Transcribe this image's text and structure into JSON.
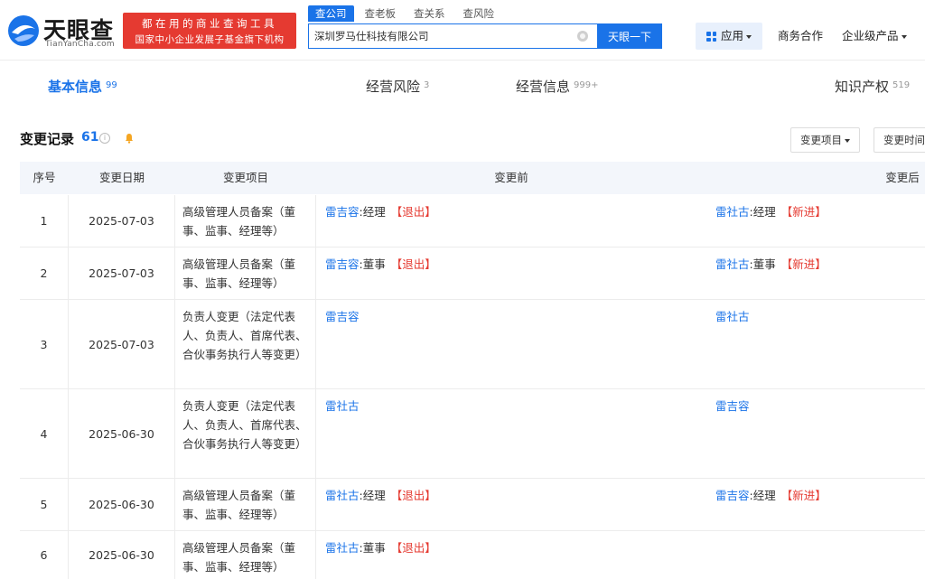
{
  "header": {
    "logo_title": "天眼查",
    "logo_sub": "TianYanCha.com",
    "banner_line1": "都在用的商业查询工具",
    "banner_line2": "国家中小企业发展子基金旗下机构",
    "search_tabs": [
      "查公司",
      "查老板",
      "查关系",
      "查风险"
    ],
    "search_value": "深圳罗马仕科技有限公司",
    "search_button": "天眼一下",
    "app_label": "应用",
    "nav_business": "商务合作",
    "nav_enterprise": "企业级产品"
  },
  "subtabs": [
    {
      "label": "基本信息",
      "count": "99"
    },
    {
      "label": "经营风险",
      "count": "3"
    },
    {
      "label": "经营信息",
      "count": "999+"
    },
    {
      "label": "知识产权",
      "count": "519"
    }
  ],
  "section": {
    "title": "变更记录",
    "count": "61",
    "info_glyph": "i",
    "filter_item": "变更项目",
    "filter_time": "变更时间"
  },
  "table": {
    "headers": {
      "no": "序号",
      "date": "变更日期",
      "item": "变更项目",
      "before": "变更前",
      "after": "变更后"
    },
    "rows": [
      {
        "no": "1",
        "date": "2025-07-03",
        "item": "高级管理人员备案（董事、监事、经理等）",
        "before_person": "雷吉容",
        "before_role": ":经理",
        "before_tag": "【退出】",
        "after_person": "雷社古",
        "after_role": ":经理",
        "after_tag": "【新进】"
      },
      {
        "no": "2",
        "date": "2025-07-03",
        "item": "高级管理人员备案（董事、监事、经理等）",
        "before_person": "雷吉容",
        "before_role": ":董事",
        "before_tag": "【退出】",
        "after_person": "雷社古",
        "after_role": ":董事",
        "after_tag": "【新进】"
      },
      {
        "no": "3",
        "date": "2025-07-03",
        "item": "负责人变更（法定代表人、负责人、首席代表、合伙事务执行人等变更）",
        "before_person": "雷吉容",
        "before_role": "",
        "before_tag": "",
        "after_person": "雷社古",
        "after_role": "",
        "after_tag": ""
      },
      {
        "no": "4",
        "date": "2025-06-30",
        "item": "负责人变更（法定代表人、负责人、首席代表、合伙事务执行人等变更）",
        "before_person": "雷社古",
        "before_role": "",
        "before_tag": "",
        "after_person": "雷吉容",
        "after_role": "",
        "after_tag": ""
      },
      {
        "no": "5",
        "date": "2025-06-30",
        "item": "高级管理人员备案（董事、监事、经理等）",
        "before_person": "雷社古",
        "before_role": ":经理",
        "before_tag": "【退出】",
        "after_person": "雷吉容",
        "after_role": ":经理",
        "after_tag": "【新进】"
      },
      {
        "no": "6",
        "date": "2025-06-30",
        "item": "高级管理人员备案（董事、监事、经理等）",
        "before_person": "雷社古",
        "before_role": ":董事",
        "before_tag": "【退出】",
        "after_person": "",
        "after_role": "",
        "after_tag": ""
      }
    ]
  },
  "colors": {
    "accent": "#1a73e8",
    "banner": "#e53a31",
    "tag": "#e53a31",
    "header_bg": "#f3f6fb"
  }
}
